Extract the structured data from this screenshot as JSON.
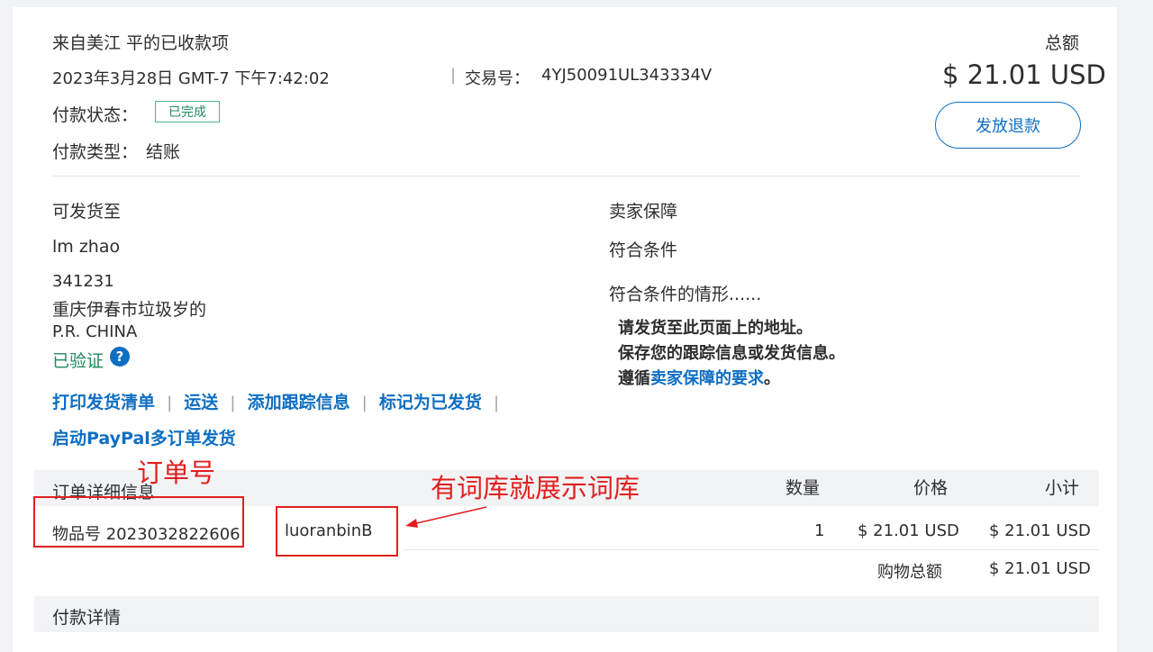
{
  "header": {
    "from_label": "来自美江 平的已收款项",
    "total_label": "总额",
    "datetime": "2023年3月28日 GMT-7 下午7:42:02",
    "txn_label": "交易号：",
    "txn_id": "4YJ50091UL343334V",
    "amount": "$ 21.01 USD",
    "status_label": "付款状态：",
    "status_value": "已完成",
    "type_label": "付款类型：",
    "type_value": "结账",
    "refund_button": "发放退款"
  },
  "shipping": {
    "title": "可发货至",
    "name": "lm zhao",
    "zip": "341231",
    "address": "重庆伊春市垃圾岁的",
    "country": "P.R. CHINA",
    "verified": "已验证",
    "help_glyph": "?"
  },
  "protection": {
    "title": "卖家保障",
    "eligibility": "符合条件",
    "conditions_title": "符合条件的情形......",
    "line1": "请发货至此页面上的地址。",
    "line2": "保存您的跟踪信息或发货信息。",
    "line3_prefix": "遵循",
    "line3_link": "卖家保障的要求",
    "line3_suffix": "。"
  },
  "actions": {
    "print_packing": "打印发货清单",
    "ship": "运送",
    "add_tracking": "添加跟踪信息",
    "mark_shipped": "标记为已发货",
    "multi_order": "启动PayPal多订单发货"
  },
  "order": {
    "title": "订单详细信息",
    "col_qty": "数量",
    "col_price": "价格",
    "col_subtotal": "小计",
    "item_id_label": "物品号 2023032822606",
    "item_name": "luoranbinB",
    "qty": "1",
    "price": "$ 21.01 USD",
    "subtotal": "$ 21.01 USD",
    "total_label": "购物总额",
    "total_value": "$ 21.01 USD"
  },
  "payment_details": {
    "title": "付款详情"
  },
  "annotations": {
    "order_number": "订单号",
    "dictionary_note": "有词库就展示词库",
    "color": "#e02020"
  }
}
